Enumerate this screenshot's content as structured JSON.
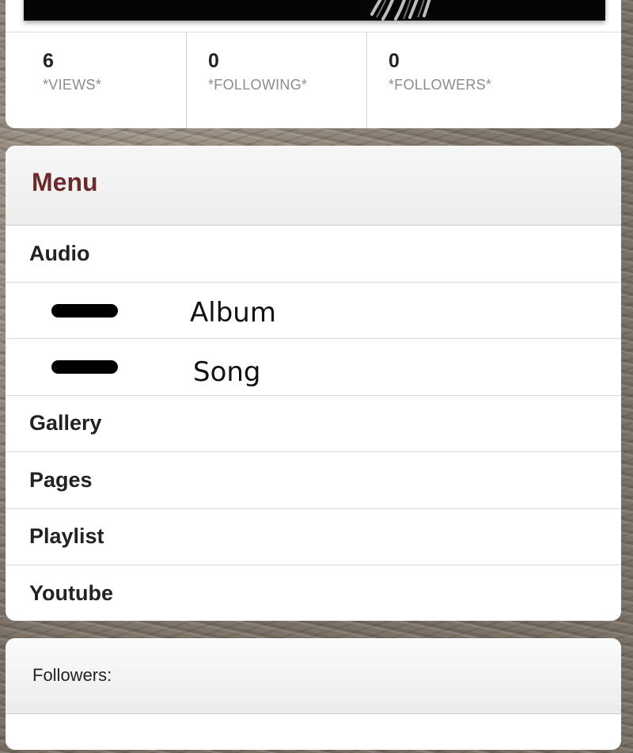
{
  "stats": [
    {
      "value": "6",
      "label": "*VIEWS*"
    },
    {
      "value": "0",
      "label": "*FOLLOWING*"
    },
    {
      "value": "0",
      "label": "*FOLLOWERS*"
    }
  ],
  "menu": {
    "title": "Menu",
    "audio": "Audio",
    "album": "Album",
    "song": "Song",
    "gallery": "Gallery",
    "pages": "Pages",
    "playlist": "Playlist",
    "youtube": "Youtube"
  },
  "followers": {
    "label": "Followers:"
  }
}
